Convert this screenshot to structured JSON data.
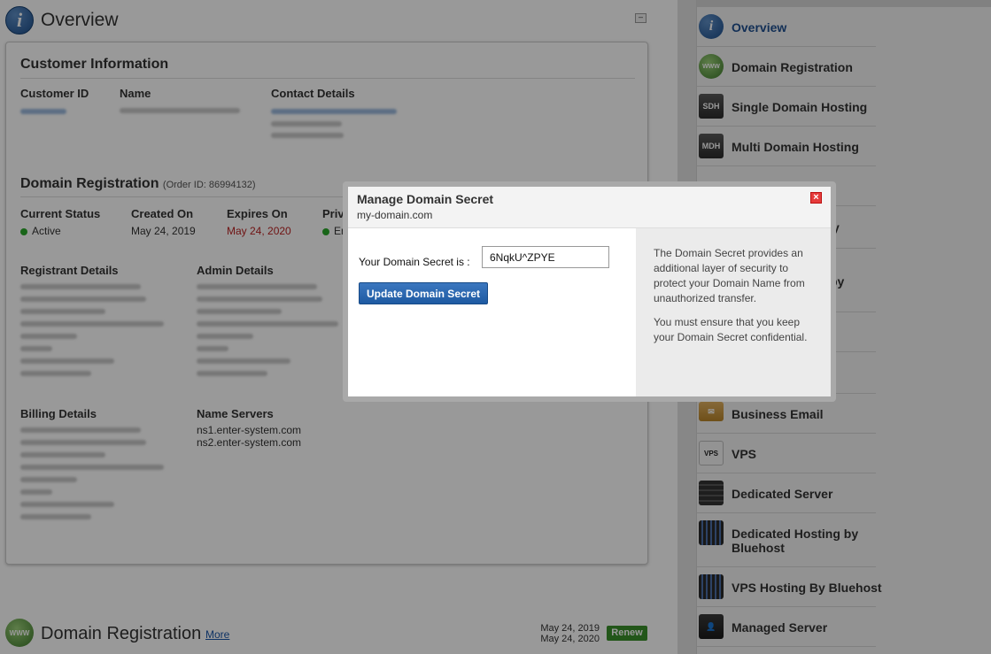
{
  "page": {
    "title": "Overview"
  },
  "customer": {
    "section_title": "Customer Information",
    "id_label": "Customer ID",
    "name_label": "Name",
    "contact_label": "Contact Details"
  },
  "domain_reg": {
    "section_title": "Domain Registration",
    "order_id": "(Order ID: 86994132)",
    "status_label": "Current Status",
    "status_value": "Active",
    "created_label": "Created On",
    "created_value": "May 24, 2019",
    "expires_label": "Expires On",
    "expires_value": "May 24, 2020",
    "privacy_label": "Priv",
    "privacy_value": "En",
    "registrant_label": "Registrant Details",
    "admin_label": "Admin Details",
    "billing_label": "Billing Details",
    "ns_label": "Name Servers",
    "ns1": "ns1.enter-system.com",
    "ns2": "ns2.enter-system.com"
  },
  "bottom_row": {
    "title": "Domain Registration",
    "more_link": "More",
    "date_start": "May 24, 2019",
    "date_end": "May 24, 2020",
    "renew_label": "Renew"
  },
  "sidebar": {
    "items": [
      {
        "label": "Overview",
        "icon": "info-icon",
        "active": true
      },
      {
        "label": "Domain Registration",
        "icon": "www-icon"
      },
      {
        "label": "Single Domain Hosting",
        "icon": "sdh-server-icon"
      },
      {
        "label": "Multi Domain Hosting",
        "icon": "mdh-server-icon"
      },
      {
        "label": "Business Email",
        "icon": "envelope-icon"
      },
      {
        "label": "VPS",
        "icon": "vps-icon"
      },
      {
        "label": "Dedicated Server",
        "icon": "dedicated-server-icon"
      },
      {
        "label": "Dedicated Hosting by Bluehost",
        "icon": "bluehost-dedicated-icon"
      },
      {
        "label": "VPS Hosting By Bluehost",
        "icon": "bluehost-vps-icon"
      },
      {
        "label": "Managed Server",
        "icon": "managed-server-icon"
      }
    ],
    "partial_labels": [
      "y",
      "by"
    ]
  },
  "modal": {
    "title": "Manage Domain Secret",
    "domain": "my-domain.com",
    "close_icon": "close-icon",
    "secret_label": "Your Domain Secret is :",
    "secret_value": "6NqkU^ZPYE",
    "update_button": "Update Domain Secret",
    "info_p1": "The Domain Secret provides an additional layer of security to protect your Domain Name from unauthorized transfer.",
    "info_p2": "You must ensure that you keep your Domain Secret confidential."
  },
  "colors": {
    "accent_blue": "#1e5aa2",
    "expired_red": "#bb2222",
    "active_green": "#2aa82a",
    "renew_green": "#3a8f2b"
  }
}
